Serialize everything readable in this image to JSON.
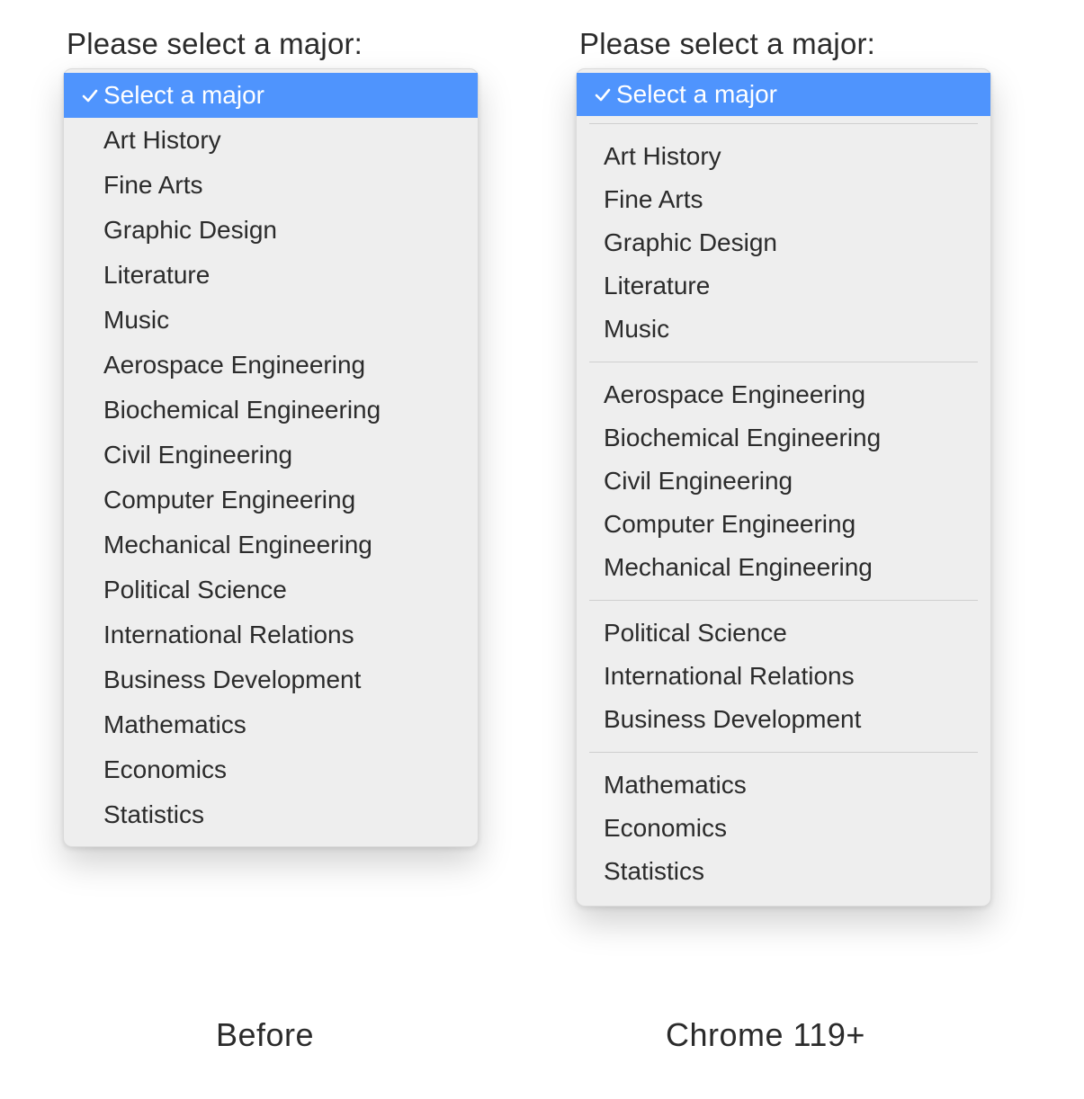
{
  "headings": {
    "left": "Please select a major:",
    "right": "Please select a major:"
  },
  "selected_label": "Select a major",
  "left_menu": {
    "items": [
      "Art History",
      "Fine Arts",
      "Graphic Design",
      "Literature",
      "Music",
      "Aerospace Engineering",
      "Biochemical Engineering",
      "Civil Engineering",
      "Computer Engineering",
      "Mechanical Engineering",
      "Political Science",
      "International Relations",
      "Business Development",
      "Mathematics",
      "Economics",
      "Statistics"
    ]
  },
  "right_menu": {
    "groups": [
      [
        "Art History",
        "Fine Arts",
        "Graphic Design",
        "Literature",
        "Music"
      ],
      [
        "Aerospace Engineering",
        "Biochemical Engineering",
        "Civil Engineering",
        "Computer Engineering",
        "Mechanical Engineering"
      ],
      [
        "Political Science",
        "International Relations",
        "Business Development"
      ],
      [
        "Mathematics",
        "Economics",
        "Statistics"
      ]
    ]
  },
  "captions": {
    "left": "Before",
    "right": "Chrome 119+"
  },
  "colors": {
    "selection": "#4f94fd",
    "panel": "#eeeeee"
  }
}
